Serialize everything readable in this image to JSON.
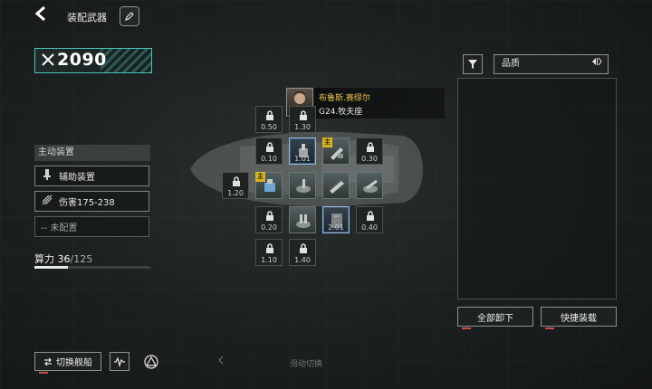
{
  "header": {
    "title": "装配武器"
  },
  "power": {
    "value": "2090"
  },
  "loadout": {
    "section_title": "主动装置",
    "slots": [
      {
        "label": "辅助装置"
      },
      {
        "label": "伤害175-238"
      },
      {
        "label": "-- 未配置"
      }
    ],
    "calc": {
      "label": "算力",
      "current": "36",
      "separator": "/",
      "max": "125",
      "fill_fraction": 0.29
    }
  },
  "pilot": {
    "name": "布鲁斯.赛缪尔",
    "ship": "G24.牧夫座",
    "level": "3"
  },
  "grid": {
    "locked_values": [
      "0.50",
      "1.30",
      "0.10",
      "0.30",
      "1.20",
      "0.20",
      "0.40",
      "1.10",
      "1.40"
    ],
    "equipped_values": [
      "1.01",
      "2.01"
    ],
    "badge": "主"
  },
  "filter": {
    "quality_label": "品质",
    "sort_icon": "sort-toggle-icon"
  },
  "actions": {
    "unequip_all": "全部卸下",
    "quick_equip": "快捷装载"
  },
  "footer": {
    "switch_ship": "切换舰船",
    "swipe_hint": "滑动切换"
  },
  "colors": {
    "accent": "#49c4b7",
    "gold": "#d9b320",
    "alert": "#c84d4d"
  }
}
